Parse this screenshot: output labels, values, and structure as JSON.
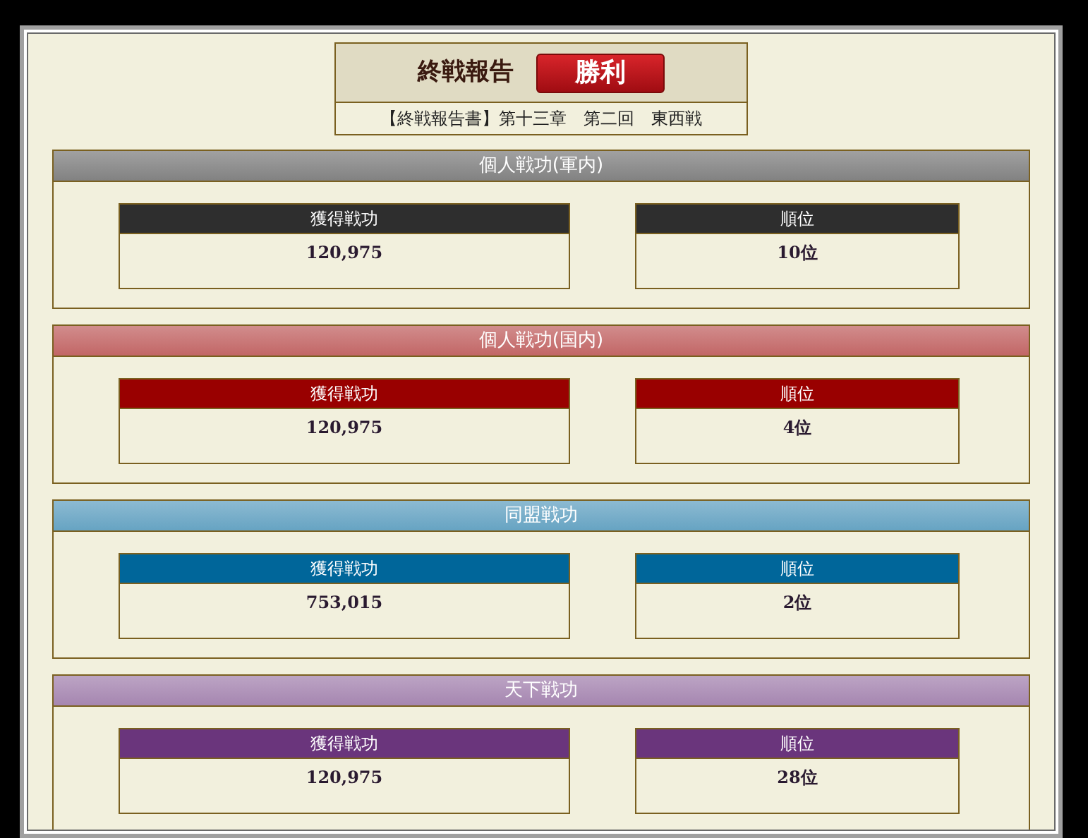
{
  "report": {
    "title": "終戦報告",
    "result": "勝利",
    "subtitle": "【終戦報告書】第十三章　第二回　東西戦"
  },
  "sections": [
    {
      "title": "個人戦功(軍内)",
      "color": "#2e2e2e",
      "stats": [
        {
          "label": "獲得戦功",
          "value": "120,975"
        },
        {
          "label": "順位",
          "value": "10位"
        }
      ]
    },
    {
      "title": "個人戦功(国内)",
      "color": "#990000",
      "stats": [
        {
          "label": "獲得戦功",
          "value": "120,975"
        },
        {
          "label": "順位",
          "value": "4位"
        }
      ]
    },
    {
      "title": "同盟戦功",
      "color": "#00669a",
      "stats": [
        {
          "label": "獲得戦功",
          "value": "753,015"
        },
        {
          "label": "順位",
          "value": "2位"
        }
      ]
    },
    {
      "title": "天下戦功",
      "color": "#6a357c",
      "stats": [
        {
          "label": "獲得戦功",
          "value": "120,975"
        },
        {
          "label": "順位",
          "value": "28位"
        }
      ]
    }
  ]
}
